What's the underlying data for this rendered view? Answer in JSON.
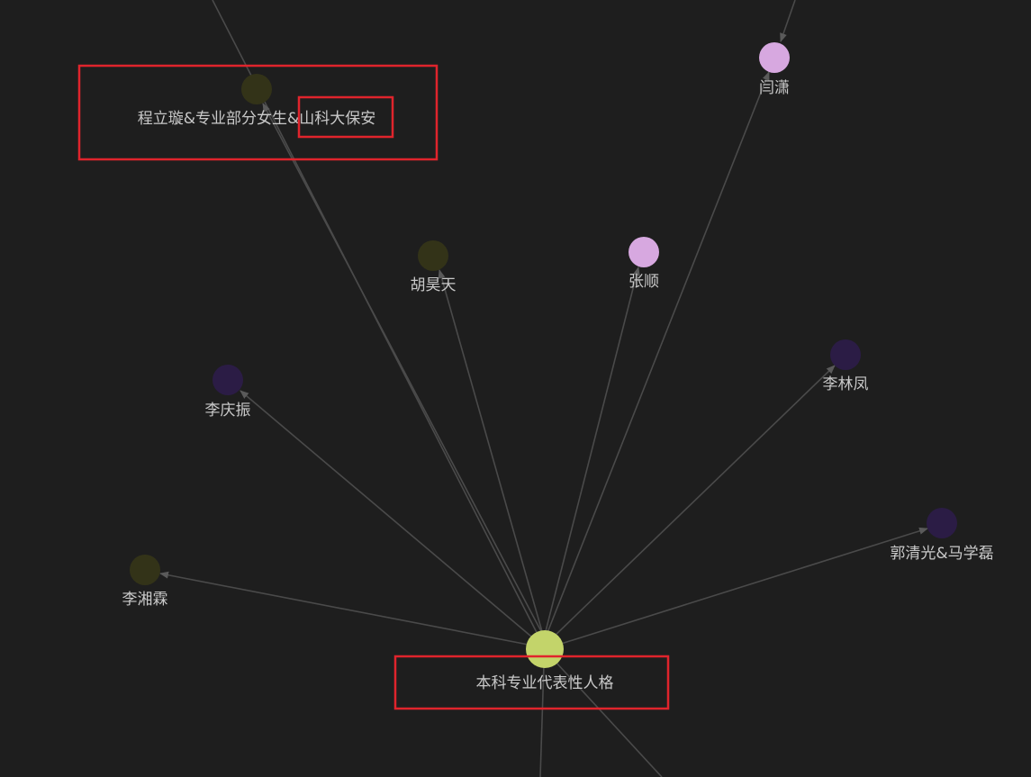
{
  "graph": {
    "nodes": {
      "center": {
        "label": "本科专业代表性人格",
        "color": "#c3d46a"
      },
      "cheng": {
        "label": "程立璇&专业部分女生&山科大保安",
        "color": "#333318"
      },
      "yan": {
        "label": "闫潇",
        "color": "#d7a8e0"
      },
      "hu": {
        "label": "胡昊天",
        "color": "#333318"
      },
      "zhang": {
        "label": "张顺",
        "color": "#d7a8e0"
      },
      "li_qz": {
        "label": "李庆振",
        "color": "#2b1c45"
      },
      "li_lf": {
        "label": "李林凤",
        "color": "#2b1c45"
      },
      "guo": {
        "label": "郭清光&马学磊",
        "color": "#2b1c45"
      },
      "li_xl": {
        "label": "李湘霖",
        "color": "#333318"
      }
    },
    "edge_color": "#4a4a4a",
    "label_color": "#c9c9c9",
    "highlight_color": "#e0242c"
  }
}
